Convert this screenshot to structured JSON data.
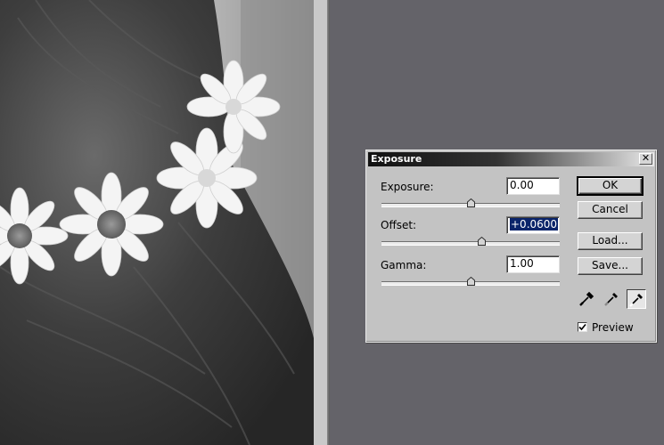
{
  "dialog": {
    "title": "Exposure",
    "close_glyph": "✕",
    "fields": [
      {
        "label": "Exposure:",
        "value": "0.00",
        "slider_fraction": 0.5
      },
      {
        "label": "Offset:",
        "value": "+0.0600",
        "slider_fraction": 0.56,
        "selected": true
      },
      {
        "label": "Gamma:",
        "value": "1.00",
        "slider_fraction": 0.5
      }
    ],
    "buttons": {
      "ok": "OK",
      "cancel": "Cancel",
      "load": "Load...",
      "save": "Save..."
    },
    "eyedroppers": [
      {
        "icon": "black-point-eyedropper-icon"
      },
      {
        "icon": "gray-point-eyedropper-icon"
      },
      {
        "icon": "white-point-eyedropper-icon",
        "active": true
      }
    ],
    "preview": {
      "label": "Preview",
      "checked": true
    }
  },
  "colors": {
    "workspace": "#646369",
    "dialog_bg": "#c3c3c3",
    "selection": "#0a246a"
  }
}
